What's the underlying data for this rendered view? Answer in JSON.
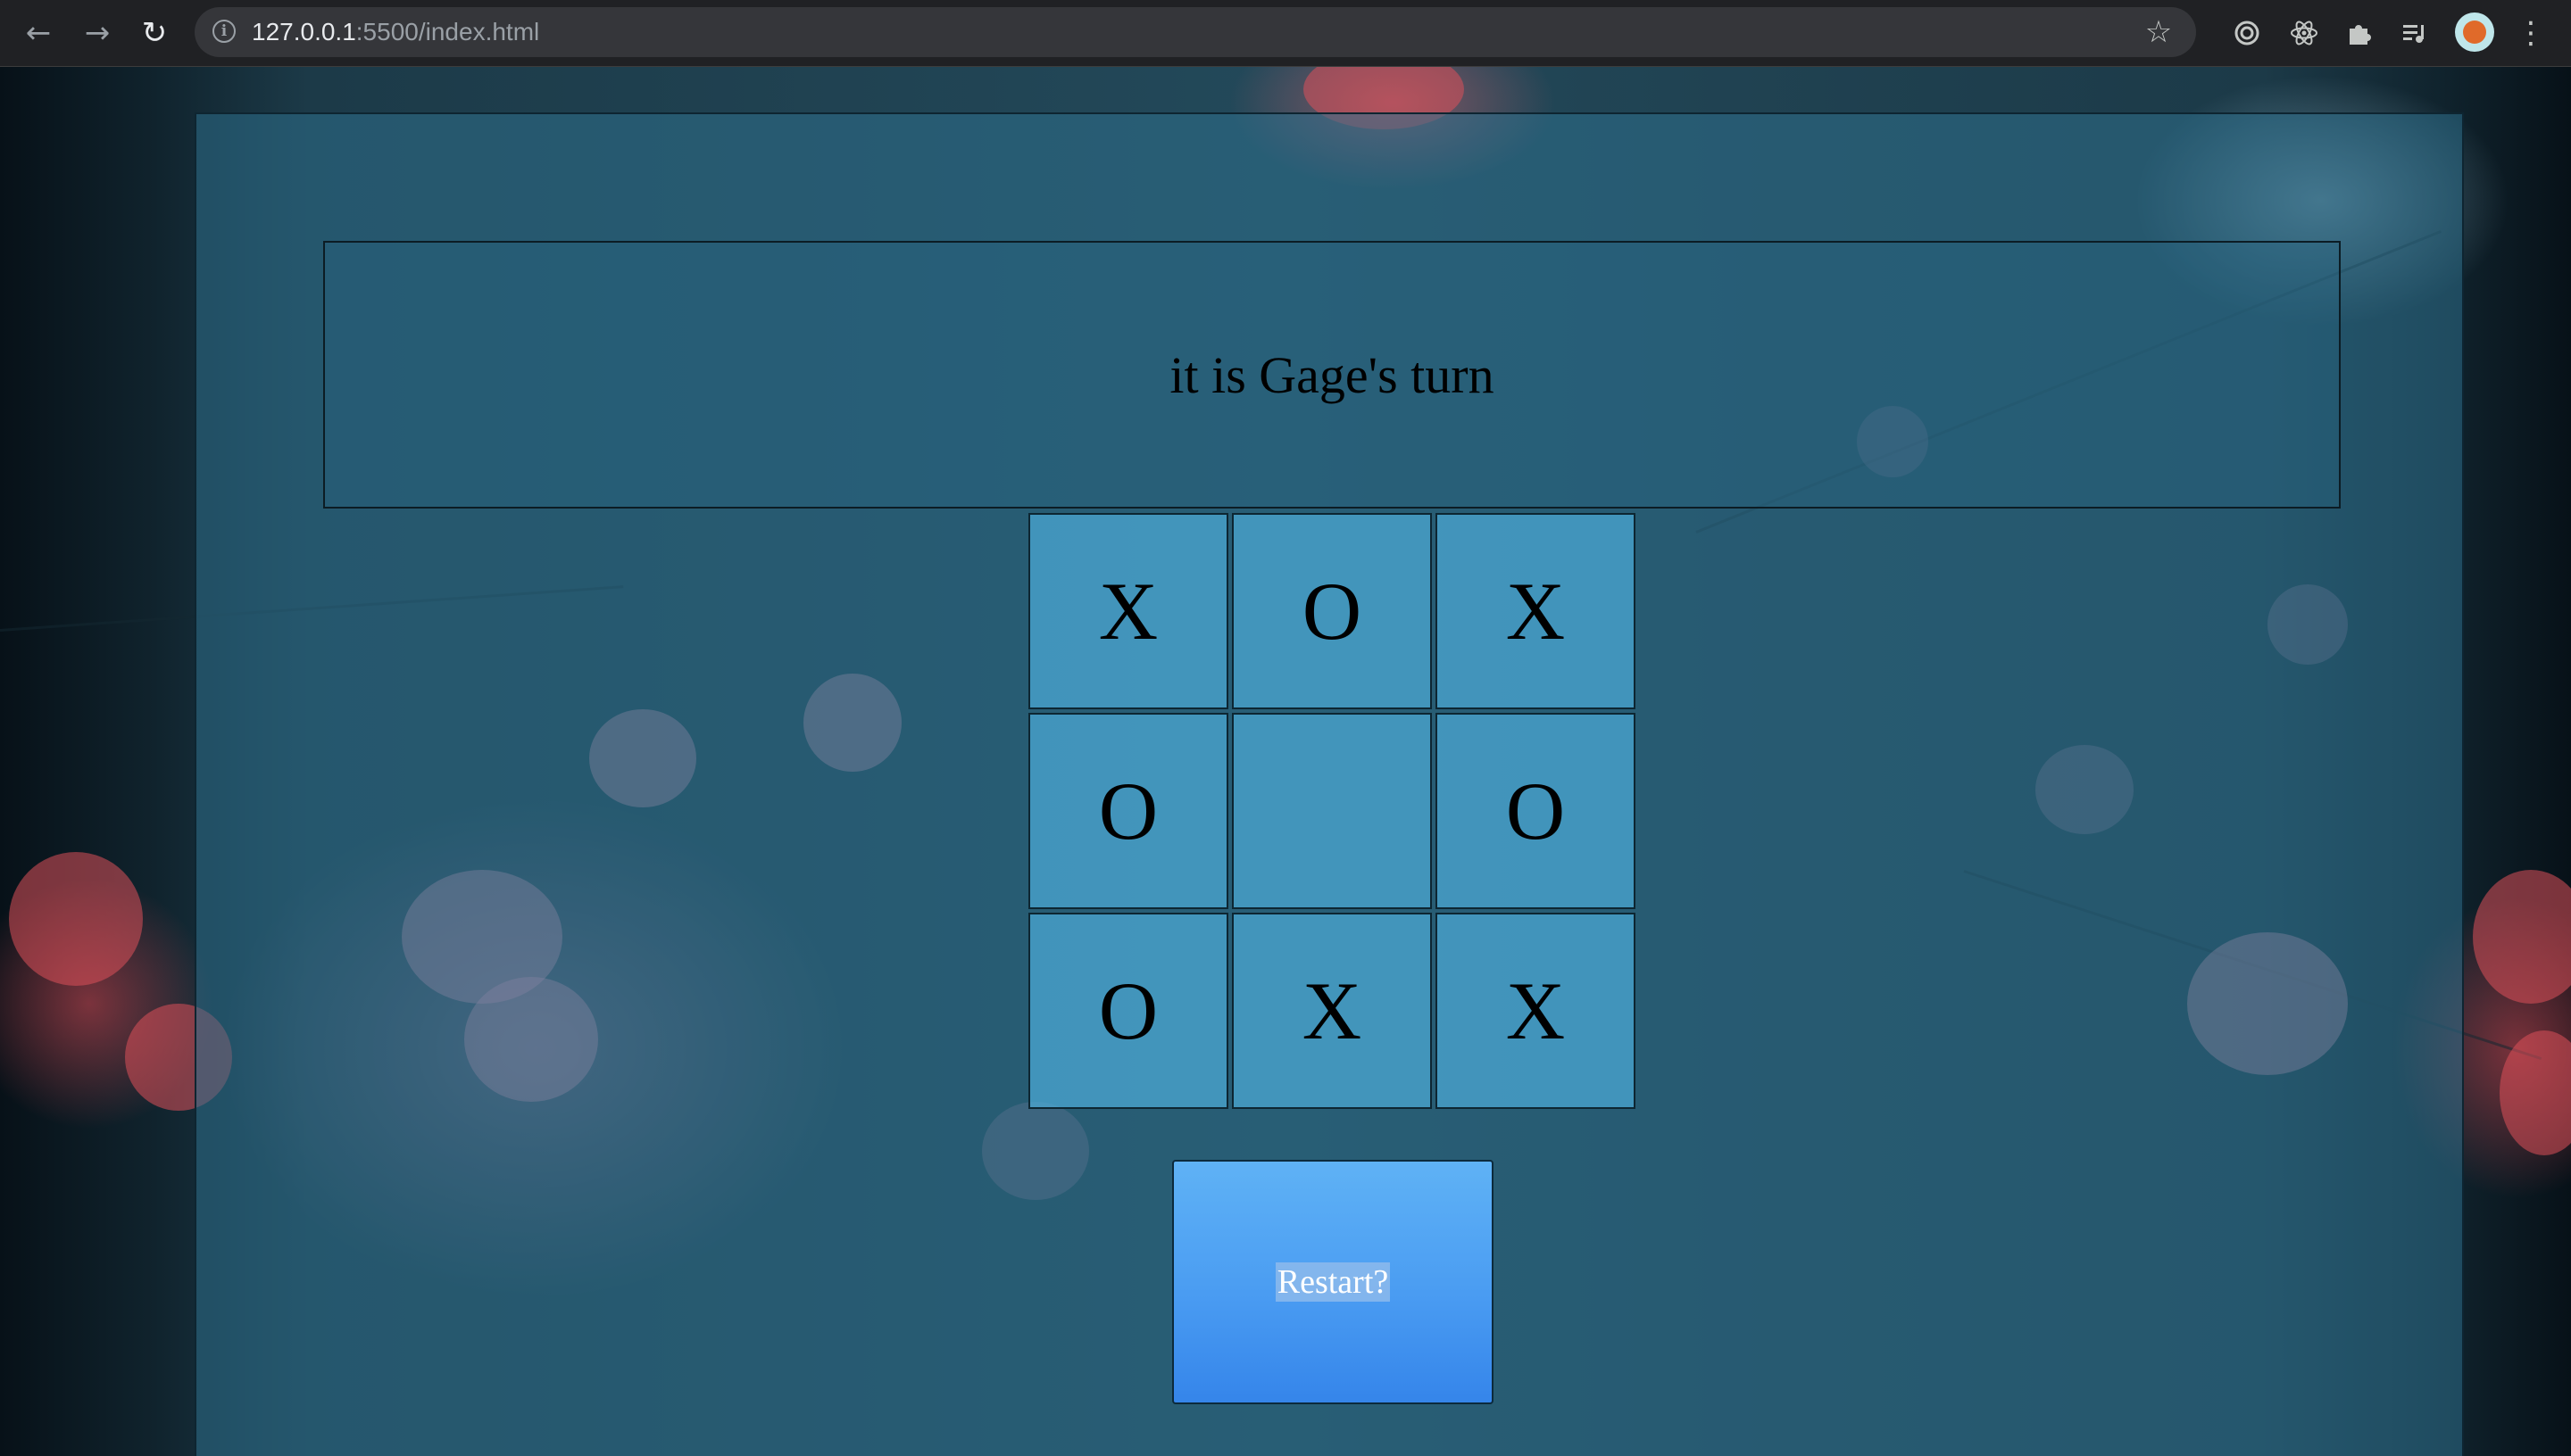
{
  "browser": {
    "url_host": "127.0.0.1",
    "url_rest": ":5500/index.html",
    "icons": {
      "back": "back-arrow-icon",
      "forward": "forward-arrow-icon",
      "reload": "reload-icon",
      "info": "site-info-icon",
      "bookmark": "bookmark-star-icon",
      "extensions": [
        "target-extension-icon",
        "react-devtools-icon",
        "puzzle-extensions-icon",
        "media-queue-icon"
      ],
      "profile": "profile-avatar",
      "menu": "kebab-menu-icon"
    }
  },
  "game": {
    "status": "it is Gage's turn",
    "board": [
      [
        "X",
        "O",
        "X"
      ],
      [
        "O",
        "",
        "O"
      ],
      [
        "O",
        "X",
        "X"
      ]
    ],
    "restart_label": "Restart?"
  },
  "colors": {
    "panel": "#2d708c",
    "cell": "#4caad7",
    "button_top": "#5fb2f5",
    "button_bottom": "#3585ea"
  }
}
